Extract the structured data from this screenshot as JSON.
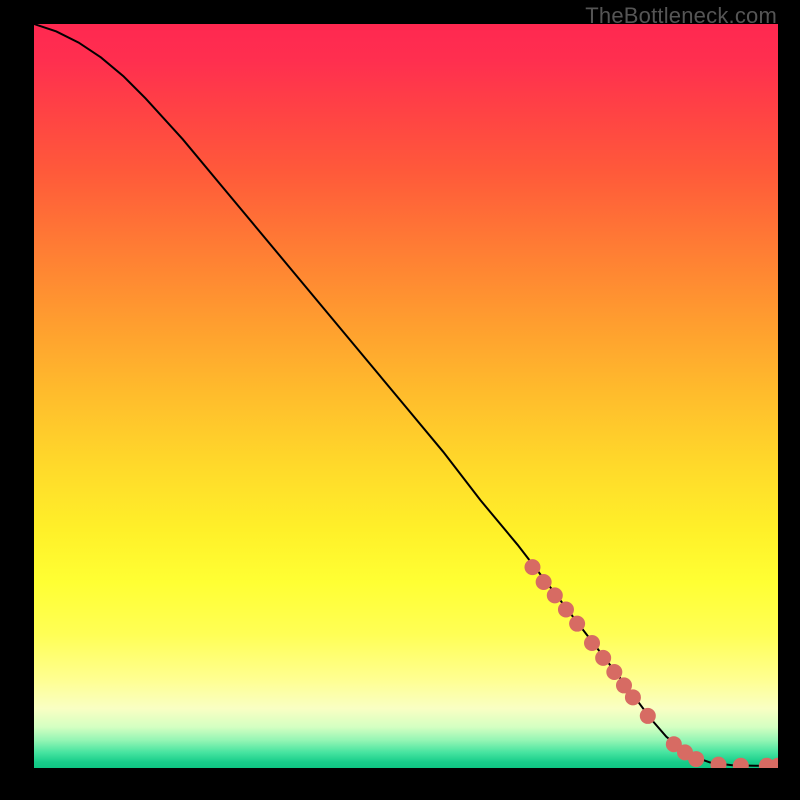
{
  "watermark": "TheBottleneck.com",
  "chart_data": {
    "type": "line",
    "title": "",
    "xlabel": "",
    "ylabel": "",
    "xlim": [
      0,
      100
    ],
    "ylim": [
      0,
      100
    ],
    "grid": false,
    "background_gradient": {
      "stops": [
        {
          "offset": 0.0,
          "color": "#ff2850"
        },
        {
          "offset": 0.05,
          "color": "#ff2f4f"
        },
        {
          "offset": 0.12,
          "color": "#ff4344"
        },
        {
          "offset": 0.2,
          "color": "#ff5a3a"
        },
        {
          "offset": 0.3,
          "color": "#ff7c34"
        },
        {
          "offset": 0.4,
          "color": "#ff9d2f"
        },
        {
          "offset": 0.5,
          "color": "#ffbd2c"
        },
        {
          "offset": 0.6,
          "color": "#ffdb2a"
        },
        {
          "offset": 0.68,
          "color": "#fff029"
        },
        {
          "offset": 0.75,
          "color": "#ffff33"
        },
        {
          "offset": 0.82,
          "color": "#ffff55"
        },
        {
          "offset": 0.88,
          "color": "#ffff90"
        },
        {
          "offset": 0.92,
          "color": "#f9ffc3"
        },
        {
          "offset": 0.945,
          "color": "#d4ffc2"
        },
        {
          "offset": 0.963,
          "color": "#93f5b4"
        },
        {
          "offset": 0.979,
          "color": "#47e4a0"
        },
        {
          "offset": 0.992,
          "color": "#18cd8a"
        },
        {
          "offset": 1.0,
          "color": "#0fc683"
        }
      ]
    },
    "series": [
      {
        "name": "curve",
        "color": "#000000",
        "type": "line",
        "x": [
          0,
          3,
          6,
          9,
          12,
          15,
          20,
          25,
          30,
          35,
          40,
          45,
          50,
          55,
          60,
          65,
          70,
          75,
          80,
          83,
          85,
          87,
          89,
          91,
          94,
          97,
          100
        ],
        "y": [
          100,
          99,
          97.5,
          95.5,
          93,
          90,
          84.5,
          78.5,
          72.5,
          66.5,
          60.5,
          54.5,
          48.5,
          42.5,
          36,
          30,
          23.5,
          17,
          10.5,
          6.5,
          4.2,
          2.6,
          1.4,
          0.7,
          0.35,
          0.3,
          0.3
        ]
      },
      {
        "name": "dots",
        "color": "#d76b63",
        "type": "scatter",
        "radius": 8,
        "points": [
          {
            "x": 67.0,
            "y": 27.0
          },
          {
            "x": 68.5,
            "y": 25.0
          },
          {
            "x": 70.0,
            "y": 23.2
          },
          {
            "x": 71.5,
            "y": 21.3
          },
          {
            "x": 73.0,
            "y": 19.4
          },
          {
            "x": 75.0,
            "y": 16.8
          },
          {
            "x": 76.5,
            "y": 14.8
          },
          {
            "x": 78.0,
            "y": 12.9
          },
          {
            "x": 79.3,
            "y": 11.1
          },
          {
            "x": 80.5,
            "y": 9.5
          },
          {
            "x": 82.5,
            "y": 7.0
          },
          {
            "x": 86.0,
            "y": 3.2
          },
          {
            "x": 87.5,
            "y": 2.1
          },
          {
            "x": 89.0,
            "y": 1.2
          },
          {
            "x": 92.0,
            "y": 0.45
          },
          {
            "x": 95.0,
            "y": 0.3
          },
          {
            "x": 98.5,
            "y": 0.3
          },
          {
            "x": 100.0,
            "y": 0.3
          }
        ]
      }
    ]
  }
}
